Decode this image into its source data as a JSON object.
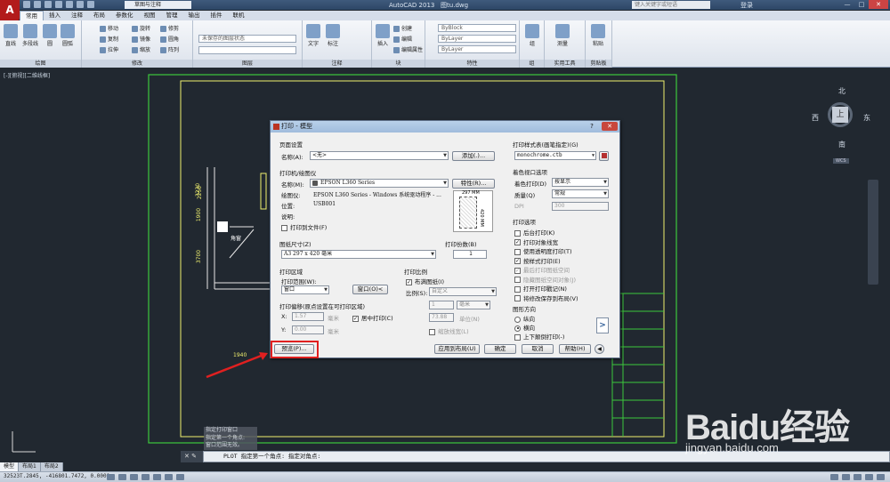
{
  "app": {
    "title": "AutoCAD 2013",
    "file": "图tu.dwg",
    "workspace": "草图与注释",
    "search_placeholder": "键入关键字或短语",
    "login": "登录"
  },
  "menu_tabs": [
    "常用",
    "插入",
    "注释",
    "布局",
    "参数化",
    "视图",
    "管理",
    "输出",
    "插件",
    "联机"
  ],
  "ribbon": {
    "groups": [
      "绘图",
      "修改",
      "图层",
      "注释",
      "块",
      "特性",
      "组",
      "实用工具",
      "剪贴板"
    ],
    "draw_buttons": [
      "直线",
      "多段线",
      "圆",
      "圆弧"
    ],
    "modify_buttons": [
      "移动",
      "旋转",
      "修剪",
      "复制",
      "镜像",
      "圆角",
      "拉伸",
      "缩放",
      "阵列"
    ],
    "layer_state": "未保存的图层状态",
    "annotation_buttons": [
      "文字",
      "标注"
    ],
    "block_buttons": [
      "插入",
      "创建",
      "编辑",
      "编辑属性"
    ],
    "properties": [
      "ByBlock",
      "ByLayer",
      "ByLayer"
    ],
    "group_buttons": [
      "组"
    ],
    "utility_buttons": [
      "测量"
    ],
    "clipboard_buttons": [
      "粘贴"
    ]
  },
  "viewport_label": "[-][俯视][二维线框]",
  "drawing": {
    "dims": [
      "3230",
      "2250",
      "1900",
      "3700",
      "1940"
    ],
    "room_label": "角窗"
  },
  "compass": {
    "north": "北",
    "south": "南",
    "east": "东",
    "west": "西",
    "center": "上",
    "wcs": "WCS"
  },
  "dialog": {
    "title": "打印 - 模型",
    "help_btn": "?",
    "page_setup": {
      "section": "页面设置",
      "name_label": "名称(A):",
      "name_value": "<无>",
      "add_btn": "添加(.)..."
    },
    "printer": {
      "section": "打印机/绘图仪",
      "name_label": "名称(M):",
      "name_value": "EPSON L360 Series",
      "properties_btn": "特性(R)...",
      "plotter_label": "绘图仪:",
      "plotter_value": "EPSON L360 Series - Windows 系统驱动程序 - ...",
      "where_label": "位置:",
      "where_value": "USB001",
      "desc_label": "说明:",
      "print_to_file": "打印到文件(F)",
      "preview_width": "297 MM",
      "preview_height": "420 MM"
    },
    "paper_size": {
      "section": "图纸尺寸(Z)",
      "value": "A3 297 x 420 毫米"
    },
    "copies": {
      "section": "打印份数(B)",
      "value": "1"
    },
    "plot_area": {
      "section": "打印区域",
      "what_label": "打印范围(W):",
      "what_value": "窗口",
      "window_btn": "窗口(O)<"
    },
    "plot_scale": {
      "section": "打印比例",
      "fit": "布满图纸(I)",
      "scale_label": "比例(S):",
      "scale_value": "自定义",
      "val1": "1",
      "unit": "毫米",
      "val2": "73.88",
      "unit2": "单位(N)",
      "lineweights": "缩放线宽(L)"
    },
    "plot_offset": {
      "section": "打印偏移(原点设置在可打印区域)",
      "x_label": "X:",
      "x_value": "1.57",
      "y_label": "Y:",
      "y_value": "0.00",
      "unit": "毫米",
      "center": "居中打印(C)"
    },
    "style_table": {
      "section": "打印样式表(画笔指定)(G)",
      "value": "monochrome.ctb"
    },
    "shaded": {
      "section": "着色视口选项",
      "shade_label": "着色打印(D)",
      "shade_value": "按显示",
      "quality_label": "质量(Q)",
      "quality_value": "常规",
      "dpi_label": "DPI",
      "dpi_value": "300"
    },
    "options": {
      "section": "打印选项",
      "items": [
        {
          "label": "后台打印(K)",
          "checked": false,
          "enabled": true
        },
        {
          "label": "打印对象线宽",
          "checked": true,
          "enabled": true
        },
        {
          "label": "使用透明度打印(T)",
          "checked": false,
          "enabled": true
        },
        {
          "label": "按样式打印(E)",
          "checked": true,
          "enabled": true
        },
        {
          "label": "最后打印图纸空间",
          "checked": true,
          "enabled": false
        },
        {
          "label": "隐藏图纸空间对象(J)",
          "checked": false,
          "enabled": false
        },
        {
          "label": "打开打印戳记(N)",
          "checked": false,
          "enabled": true
        },
        {
          "label": "将修改保存到布局(V)",
          "checked": false,
          "enabled": true
        }
      ]
    },
    "orientation": {
      "section": "图形方向",
      "portrait": "纵向",
      "landscape": "横向",
      "upside": "上下颠倒打印(-)"
    },
    "buttons": {
      "preview": "预览(P)...",
      "apply": "应用到布局(U)",
      "ok": "确定",
      "cancel": "取消",
      "help": "帮助(H)"
    }
  },
  "command": {
    "history": [
      "指定打印窗口",
      "指定第一个角点:",
      "窗口范围无效。"
    ],
    "prompt": "PLOT 指定第一个角点: 指定对角点:"
  },
  "layout_tabs": [
    "模型",
    "布局1",
    "布局2"
  ],
  "status": {
    "coords": "32523T.2845, -416801.7472, 0.0000"
  },
  "watermark": {
    "brand": "Baidu经验",
    "url": "jingyan.baidu.com"
  },
  "colors": {
    "canvas": "#212830",
    "cad_green": "#3cc83c",
    "cad_yellow": "#f0f06e",
    "annotation_red": "#e02020"
  }
}
